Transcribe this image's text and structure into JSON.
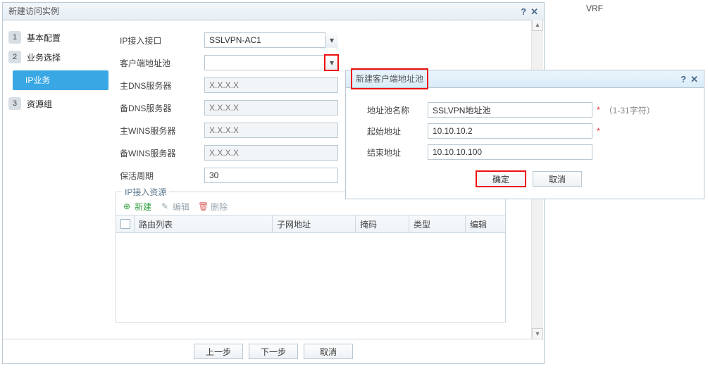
{
  "main": {
    "title": "新建访问实例",
    "steps": [
      {
        "num": "1",
        "label": "基本配置"
      },
      {
        "num": "2",
        "label": "业务选择"
      },
      {
        "num": "3",
        "label": "资源组"
      }
    ],
    "sub_tab": "IP业务",
    "form": {
      "ip_interface": {
        "label": "IP接入接口",
        "value": "SSLVPN-AC1"
      },
      "client_pool": {
        "label": "客户端地址池",
        "value": ""
      },
      "primary_dns": {
        "label": "主DNS服务器",
        "placeholder": "X.X.X.X"
      },
      "backup_dns": {
        "label": "备DNS服务器",
        "placeholder": "X.X.X.X"
      },
      "primary_wins": {
        "label": "主WINS服务器",
        "placeholder": "X.X.X.X"
      },
      "backup_wins": {
        "label": "备WINS服务器",
        "placeholder": "X.X.X.X"
      },
      "keepalive": {
        "label": "保活周期",
        "value": "30"
      }
    },
    "resource": {
      "legend": "IP接入资源",
      "toolbar": {
        "add": "新建",
        "edit": "编辑",
        "delete": "删除"
      },
      "columns": [
        "路由列表",
        "子网地址",
        "掩码",
        "类型",
        "编辑"
      ]
    },
    "footer": {
      "prev": "上一步",
      "next": "下一步",
      "cancel": "取消"
    }
  },
  "vrf_label": "VRF",
  "popup": {
    "title": "新建客户端地址池",
    "pool_name": {
      "label": "地址池名称",
      "value": "SSLVPN地址池",
      "hint": "（1-31字符）"
    },
    "start_addr": {
      "label": "起始地址",
      "value": "10.10.10.2"
    },
    "end_addr": {
      "label": "结束地址",
      "value": "10.10.10.100"
    },
    "ok": "确定",
    "cancel": "取消"
  }
}
